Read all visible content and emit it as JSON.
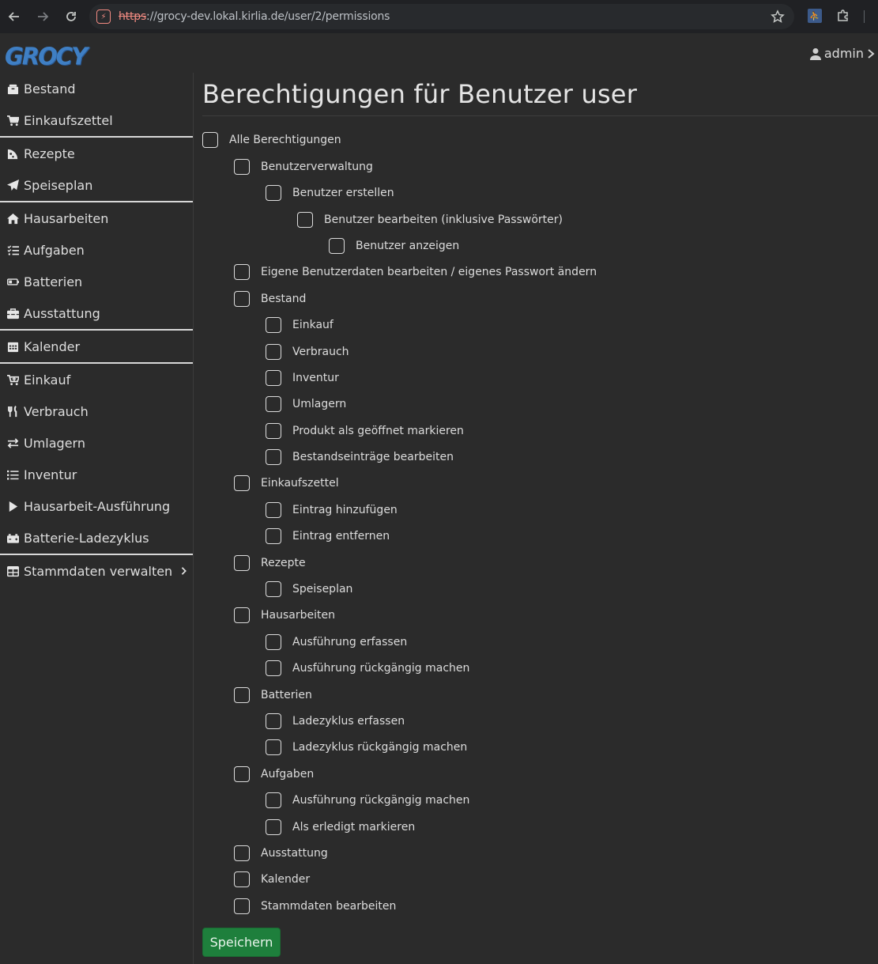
{
  "browser": {
    "url_scheme": "https",
    "url_rest": "://grocy-dev.lokal.kirlia.de/user/2/permissions"
  },
  "app": {
    "logo_text": "GROCY",
    "user_label": "admin"
  },
  "sidebar": {
    "items": [
      {
        "label": "Bestand",
        "icon": "box-icon"
      },
      {
        "label": "Einkaufszettel",
        "icon": "cart-icon"
      },
      {
        "label": "Rezepte",
        "icon": "pizza-icon"
      },
      {
        "label": "Speiseplan",
        "icon": "paper-plane-icon"
      },
      {
        "label": "Hausarbeiten",
        "icon": "home-icon"
      },
      {
        "label": "Aufgaben",
        "icon": "tasks-icon"
      },
      {
        "label": "Batterien",
        "icon": "battery-icon"
      },
      {
        "label": "Ausstattung",
        "icon": "toolbox-icon"
      },
      {
        "label": "Kalender",
        "icon": "calendar-icon"
      },
      {
        "label": "Einkauf",
        "icon": "cart-plus-icon"
      },
      {
        "label": "Verbrauch",
        "icon": "utensils-icon"
      },
      {
        "label": "Umlagern",
        "icon": "exchange-icon"
      },
      {
        "label": "Inventur",
        "icon": "list-icon"
      },
      {
        "label": "Hausarbeit-Ausführung",
        "icon": "play-icon"
      },
      {
        "label": "Batterie-Ladezyklus",
        "icon": "car-battery-icon"
      },
      {
        "label": "Stammdaten verwalten",
        "icon": "table-icon"
      }
    ]
  },
  "main": {
    "title": "Berechtigungen für Benutzer user",
    "permissions": [
      {
        "label": "Alle Berechtigungen",
        "level": 0,
        "checked": false
      },
      {
        "label": "Benutzerverwaltung",
        "level": 1,
        "checked": false
      },
      {
        "label": "Benutzer erstellen",
        "level": 2,
        "checked": false
      },
      {
        "label": "Benutzer bearbeiten (inklusive Passwörter)",
        "level": 3,
        "checked": false
      },
      {
        "label": "Benutzer anzeigen",
        "level": 4,
        "checked": false
      },
      {
        "label": "Eigene Benutzerdaten bearbeiten / eigenes Passwort ändern",
        "level": 1,
        "checked": false
      },
      {
        "label": "Bestand",
        "level": 1,
        "checked": false
      },
      {
        "label": "Einkauf",
        "level": 2,
        "checked": false
      },
      {
        "label": "Verbrauch",
        "level": 2,
        "checked": false
      },
      {
        "label": "Inventur",
        "level": 2,
        "checked": false
      },
      {
        "label": "Umlagern",
        "level": 2,
        "checked": false
      },
      {
        "label": "Produkt als geöffnet markieren",
        "level": 2,
        "checked": false
      },
      {
        "label": "Bestandseinträge bearbeiten",
        "level": 2,
        "checked": false
      },
      {
        "label": "Einkaufszettel",
        "level": 1,
        "checked": false
      },
      {
        "label": "Eintrag hinzufügen",
        "level": 2,
        "checked": false
      },
      {
        "label": "Eintrag entfernen",
        "level": 2,
        "checked": false
      },
      {
        "label": "Rezepte",
        "level": 1,
        "checked": false
      },
      {
        "label": "Speiseplan",
        "level": 2,
        "checked": false
      },
      {
        "label": "Hausarbeiten",
        "level": 1,
        "checked": false
      },
      {
        "label": "Ausführung erfassen",
        "level": 2,
        "checked": false
      },
      {
        "label": "Ausführung rückgängig machen",
        "level": 2,
        "checked": false
      },
      {
        "label": "Batterien",
        "level": 1,
        "checked": false
      },
      {
        "label": "Ladezyklus erfassen",
        "level": 2,
        "checked": false
      },
      {
        "label": "Ladezyklus rückgängig machen",
        "level": 2,
        "checked": false
      },
      {
        "label": "Aufgaben",
        "level": 1,
        "checked": false
      },
      {
        "label": "Ausführung rückgängig machen",
        "level": 2,
        "checked": false
      },
      {
        "label": "Als erledigt markieren",
        "level": 2,
        "checked": false
      },
      {
        "label": "Ausstattung",
        "level": 1,
        "checked": false
      },
      {
        "label": "Kalender",
        "level": 1,
        "checked": false
      },
      {
        "label": "Stammdaten bearbeiten",
        "level": 1,
        "checked": false
      }
    ],
    "save_label": "Speichern"
  }
}
